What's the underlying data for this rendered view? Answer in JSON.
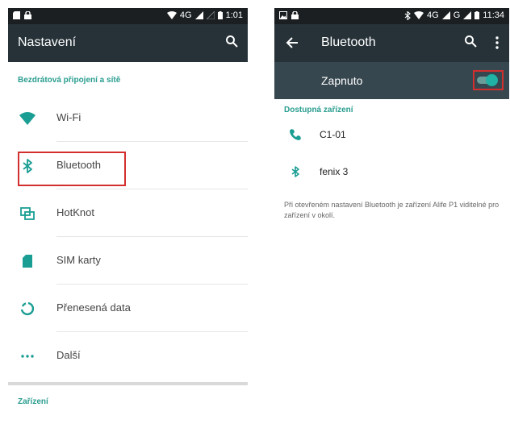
{
  "left": {
    "status": {
      "network": "4G",
      "time": "1:01"
    },
    "title": "Nastavení",
    "section_wireless": "Bezdrátová připojení a sítě",
    "items": [
      {
        "label": "Wi-Fi",
        "icon": "wifi-icon"
      },
      {
        "label": "Bluetooth",
        "icon": "bluetooth-icon"
      },
      {
        "label": "HotKnot",
        "icon": "hotknot-icon"
      },
      {
        "label": "SIM karty",
        "icon": "sim-card-icon"
      },
      {
        "label": "Přenesená data",
        "icon": "data-usage-icon"
      },
      {
        "label": "Další",
        "icon": "more-dots-icon"
      }
    ],
    "section_devices": "Zařízení"
  },
  "right": {
    "status": {
      "network": "4G",
      "network2": "G",
      "time": "11:34"
    },
    "title": "Bluetooth",
    "switch_label": "Zapnuto",
    "switch_on": true,
    "section_available": "Dostupná zařízení",
    "devices": [
      {
        "name": "C1-01",
        "icon": "phone-icon"
      },
      {
        "name": "fenix 3",
        "icon": "bluetooth-icon"
      }
    ],
    "note": "Při otevřeném nastavení Bluetooth je zařízení Alife P1 viditelné pro zařízení v okolí."
  },
  "colors": {
    "accent": "#1a9e93",
    "appbar": "#263238",
    "subbar": "#37474f",
    "highlight": "#d32f2f"
  }
}
